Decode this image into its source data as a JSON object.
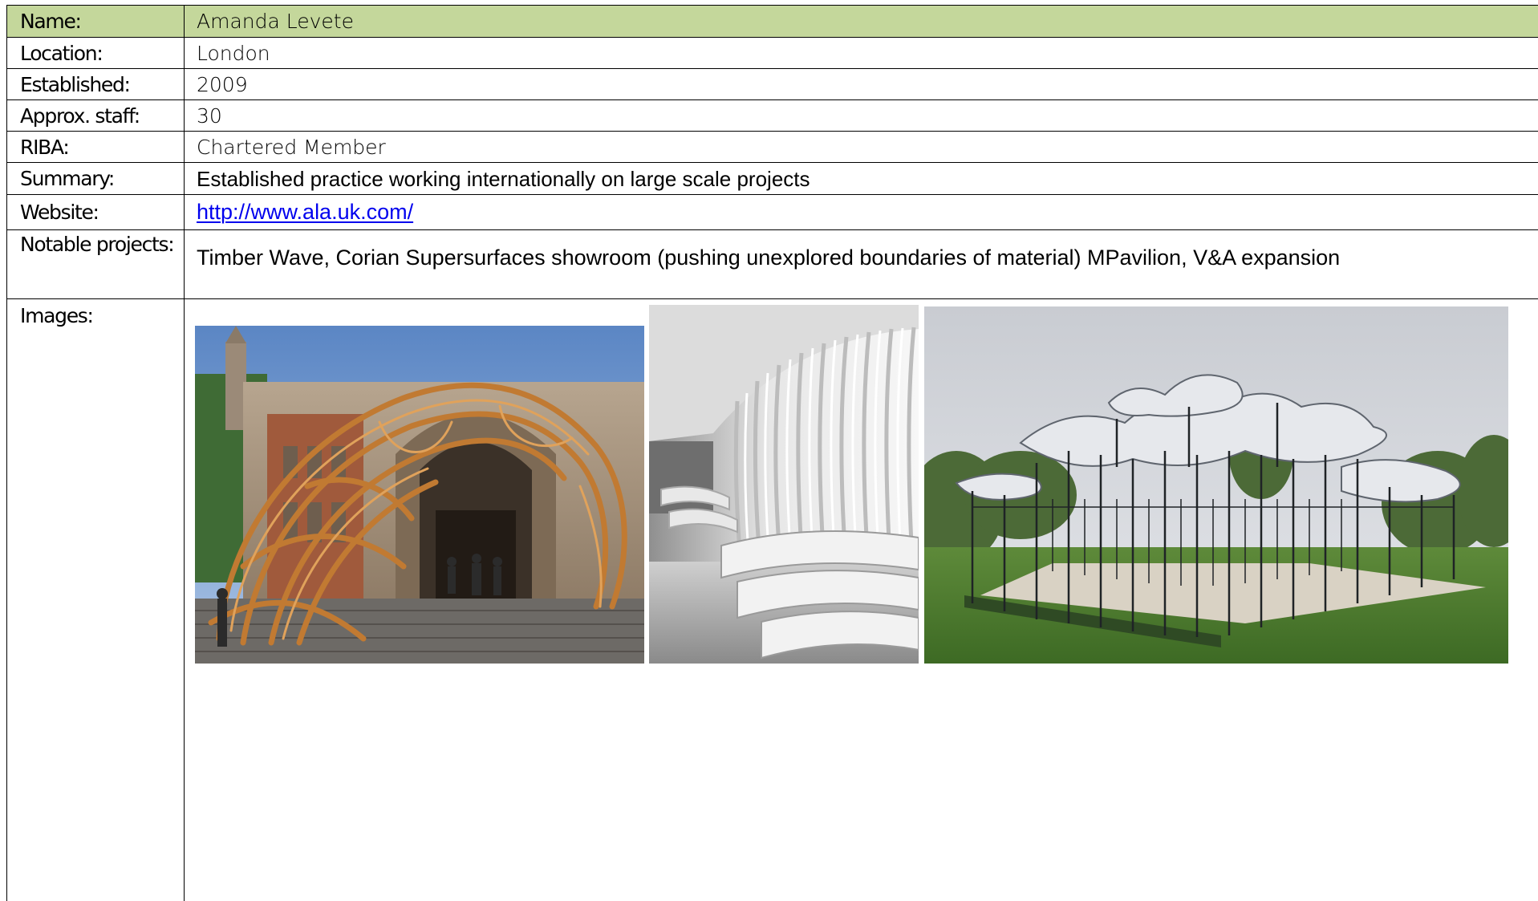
{
  "profile": {
    "name": {
      "label": "Name:",
      "value": "Amanda Levete"
    },
    "location": {
      "label": "Location:",
      "value": "London"
    },
    "established": {
      "label": "Established:",
      "value": "2009"
    },
    "staff": {
      "label": "Approx. staff:",
      "value": "30"
    },
    "riba": {
      "label": "RIBA:",
      "value": "Chartered Member"
    },
    "summary": {
      "label": "Summary:",
      "value": "Established practice working internationally on large scale projects"
    },
    "website": {
      "label": "Website:",
      "value": "http://www.ala.uk.com/"
    },
    "notable": {
      "label": "Notable projects:",
      "value": "Timber Wave, Corian Supersurfaces showroom (pushing unexplored boundaries of material) MPavilion, V&A expansion"
    },
    "images": {
      "label": "Images:"
    }
  },
  "colors": {
    "header_fill": "#c4d79b",
    "border": "#000000",
    "link": "#0000ee"
  }
}
